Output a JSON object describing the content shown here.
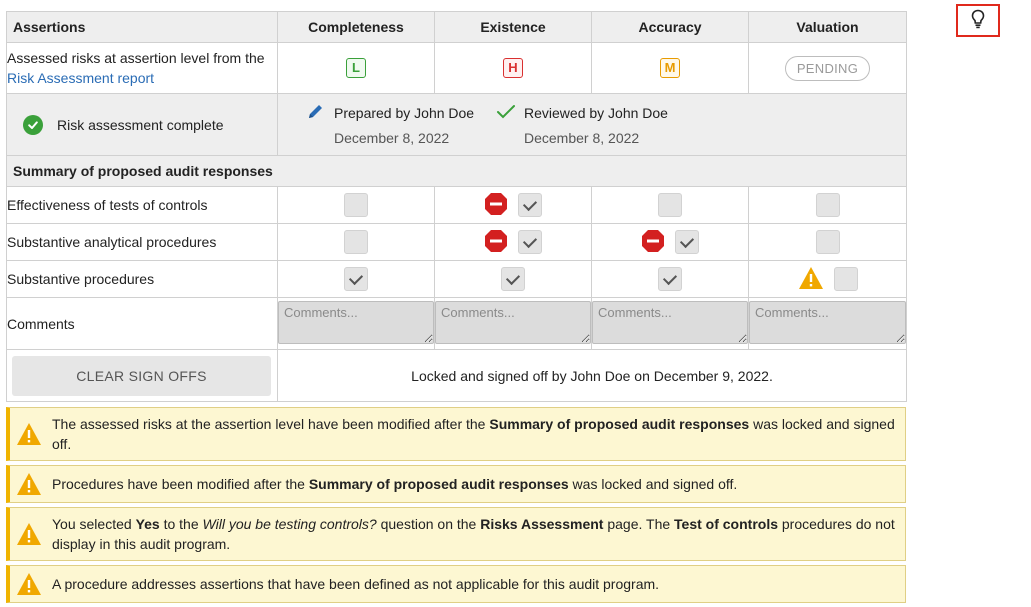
{
  "header": {
    "assertions_label": "Assertions",
    "columns": [
      "Completeness",
      "Existence",
      "Accuracy",
      "Valuation"
    ]
  },
  "risk_row": {
    "label_prefix": "Assessed risks at assertion level from the ",
    "link_text": "Risk Assessment report",
    "badges": [
      "L",
      "H",
      "M"
    ],
    "pending_label": "PENDING"
  },
  "signoff": {
    "status": "Risk assessment complete",
    "prepared_by": "Prepared by John Doe",
    "prepared_date": "December 8, 2022",
    "reviewed_by": "Reviewed by John Doe",
    "reviewed_date": "December 8, 2022"
  },
  "summary_title": "Summary of proposed audit responses",
  "procedures": [
    {
      "label": "Effectiveness of tests of controls"
    },
    {
      "label": "Substantive analytical procedures"
    },
    {
      "label": "Substantive procedures"
    }
  ],
  "comments": {
    "label": "Comments",
    "placeholder": "Comments..."
  },
  "actions": {
    "clear_label": "CLEAR SIGN OFFS",
    "locked_text": "Locked and signed off by John Doe on December 9, 2022."
  },
  "alerts": {
    "a1": {
      "pre": "The assessed risks at the assertion level have been modified after the ",
      "bold": "Summary of proposed audit responses",
      "post": " was locked and signed off."
    },
    "a2": {
      "pre": "Procedures have been modified after the ",
      "bold": "Summary of proposed audit responses",
      "post": " was locked and signed off."
    },
    "a3": {
      "t1": "You selected ",
      "b1": "Yes",
      "t2": " to the ",
      "i1": "Will you be testing controls?",
      "t3": " question on the ",
      "b2": "Risks Assessment",
      "t4": " page. The ",
      "b3": "Test of controls",
      "t5": " procedures do not display in this audit program."
    },
    "a4": {
      "text": "A procedure addresses assertions that have been defined as not applicable for this audit program."
    }
  },
  "colors": {
    "low": "#3aa03a",
    "high": "#d93030",
    "medium": "#e89b00",
    "warning": "#f0b400",
    "alert_bg": "#fdf7d2",
    "highlight_box": "#e0291c"
  }
}
